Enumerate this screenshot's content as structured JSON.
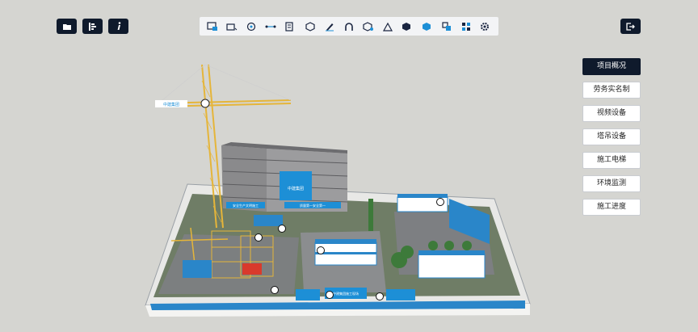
{
  "colors": {
    "dark": "#0f1a2c",
    "accent": "#1d8fd6",
    "background": "#d5d5d1"
  },
  "top_left_buttons": [
    {
      "icon": "folder-icon"
    },
    {
      "icon": "list-icon"
    },
    {
      "icon": "info-icon"
    }
  ],
  "toolbar": {
    "tools": [
      "screenshot-icon",
      "measure-icon",
      "roam-icon",
      "distance-icon",
      "layer-icon",
      "box-icon",
      "draw-icon",
      "arch-icon",
      "model-icon",
      "terrain-icon",
      "view-icon",
      "cube-icon",
      "explode-icon",
      "grid-icon",
      "settings-icon"
    ]
  },
  "exit_button": {
    "icon": "exit-icon"
  },
  "side_menu": {
    "active_index": 0,
    "items": [
      "项目概况",
      "劳务实名制",
      "视频设备",
      "塔吊设备",
      "施工电梯",
      "环境监测",
      "施工进度"
    ]
  },
  "scene": {
    "crane_sign": "中建集团",
    "building_sign": "中建集团",
    "billboard_left": "安全生产文明施工",
    "billboard_right": "质量第一安全第一",
    "gate_banner": "中建集团施工现场"
  }
}
